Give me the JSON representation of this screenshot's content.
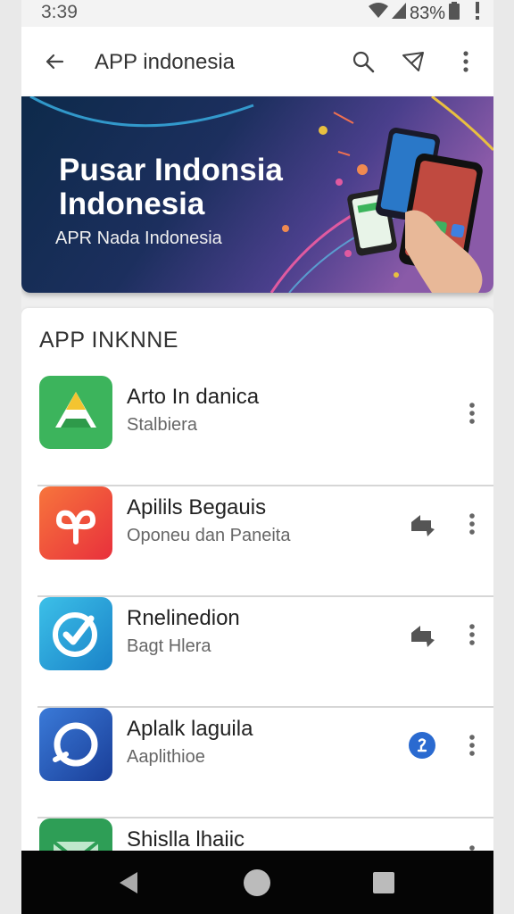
{
  "status": {
    "time": "3:39",
    "battery": "83%"
  },
  "appbar": {
    "title": "APP indonesia"
  },
  "banner": {
    "title": "Pusar Indonsia Indonesia",
    "subtitle": "APR Nada Indonesia"
  },
  "section": {
    "title": "APP INKNNE"
  },
  "apps": [
    {
      "name": "Arto In danica",
      "subtitle": "Stalbiera",
      "icon": "triangle-drive-icon",
      "color": "#3cb45c"
    },
    {
      "name": "Apilils Begauis",
      "subtitle": "Oponeu dan Paneita",
      "icon": "red-plus-loop-icon",
      "color": "#ef4a3c"
    },
    {
      "name": "Rnelinedion",
      "subtitle": "Bagt Hlera",
      "icon": "check-circle-icon",
      "color": "#2aa0d8"
    },
    {
      "name": "Aplalk laguila",
      "subtitle": "Aaplithioe",
      "icon": "blue-ring-icon",
      "color": "#2a62c0"
    },
    {
      "name": "Shislla lhaiic",
      "subtitle": "",
      "icon": "green-envelope-icon",
      "color": "#2e9e56"
    }
  ]
}
